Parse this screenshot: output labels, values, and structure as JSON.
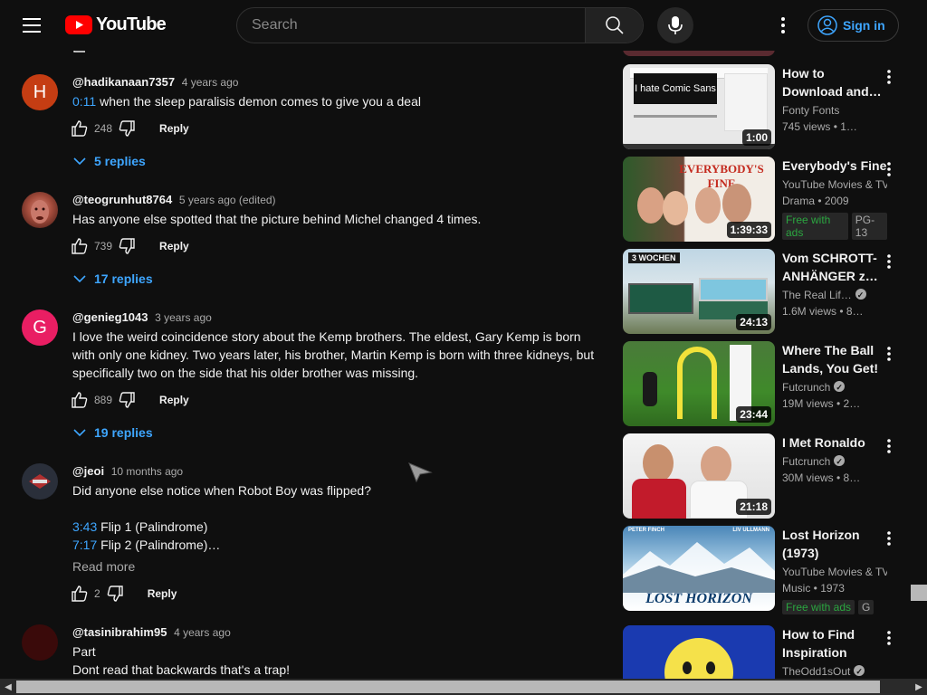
{
  "header": {
    "logo_text": "YouTube",
    "search_placeholder": "Search",
    "sign_in_label": "Sign in"
  },
  "comments": [
    {
      "author": "@hadikanaan7357",
      "time": "4 years ago",
      "avatar_letter": "H",
      "avatar_color": "#c53d13",
      "timestamp_link": "0:11",
      "text": "when the sleep paralisis demon comes to give you a deal",
      "likes": "248",
      "reply_label": "Reply",
      "replies_label": "5 replies"
    },
    {
      "author": "@teogrunhut8764",
      "time": "5 years ago (edited)",
      "avatar_letter": "",
      "avatar_color": "#7a3b2e",
      "text": "Has anyone else spotted that the picture behind Michel changed 4 times.",
      "likes": "739",
      "reply_label": "Reply",
      "replies_label": "17 replies"
    },
    {
      "author": "@genieg1043",
      "time": "3 years ago",
      "avatar_letter": "G",
      "avatar_color": "#e91e63",
      "text": "I love the weird coincidence story about the Kemp brothers. The eldest, Gary Kemp is born with only one kidney. Two years later, his brother, Martin Kemp is born with three kidneys, but specifically two on the side that his older brother was missing.",
      "likes": "889",
      "reply_label": "Reply",
      "replies_label": "19 replies"
    },
    {
      "author": "@jeoi",
      "time": "10 months ago",
      "avatar_letter": "",
      "avatar_color": "#2a2f3a",
      "text": "Did anyone else notice when Robot Boy was flipped?",
      "line1_ts": "3:43",
      "line1_text": "Flip 1 (Palindrome)",
      "line2_ts": "7:17",
      "line2_text": "Flip 2 (Palindrome)…",
      "read_more": "Read more",
      "likes": "2",
      "reply_label": "Reply"
    },
    {
      "author": "@tasinibrahim95",
      "time": "4 years ago",
      "avatar_letter": "",
      "avatar_color": "#3a0a0a",
      "text_line1": "Part",
      "text_line2": "Dont read that backwards that's a trap!"
    }
  ],
  "sidebar": {
    "videos": [
      {
        "title": "How to Download and…",
        "channel": "Fonty Fonts",
        "meta": "745 views • 1…",
        "duration": "1:00",
        "thumb_caption": "I hate Comic Sans"
      },
      {
        "title": "Everybody's Fine",
        "channel": "YouTube Movies & TV",
        "meta": "Drama • 2009",
        "duration": "1:39:33",
        "badge1": "Free with ads",
        "badge2": "PG-13",
        "thumb_caption": "EVERYBODY'S FINE"
      },
      {
        "title": "Vom SCHROTT-ANHÄNGER z…",
        "channel": "The Real Lif…",
        "meta": "1.6M views • 8…",
        "duration": "24:13",
        "thumb_caption": "3 WOCHEN"
      },
      {
        "title": "Where The Ball Lands, You Get!",
        "channel": "Futcrunch",
        "meta": "19M views • 2…",
        "duration": "23:44"
      },
      {
        "title": "I Met Ronaldo",
        "channel": "Futcrunch",
        "meta": "30M views • 8…",
        "duration": "21:18"
      },
      {
        "title": "Lost Horizon (1973)",
        "channel": "YouTube Movies & TV",
        "meta": "Music • 1973",
        "badge1": "Free with ads",
        "badge2": "G",
        "thumb_caption": "LOST HORIZON",
        "thumb_top_left": "PETER FINCH",
        "thumb_top_right": "LIV ULLMANN"
      },
      {
        "title": "How to Find Inspiration",
        "channel": "TheOdd1sOut",
        "meta": ""
      }
    ]
  },
  "colors": {
    "background": "#0f0f0f",
    "link": "#3ea6ff",
    "brand_red": "#ff0000",
    "free_green": "#2ba640"
  }
}
